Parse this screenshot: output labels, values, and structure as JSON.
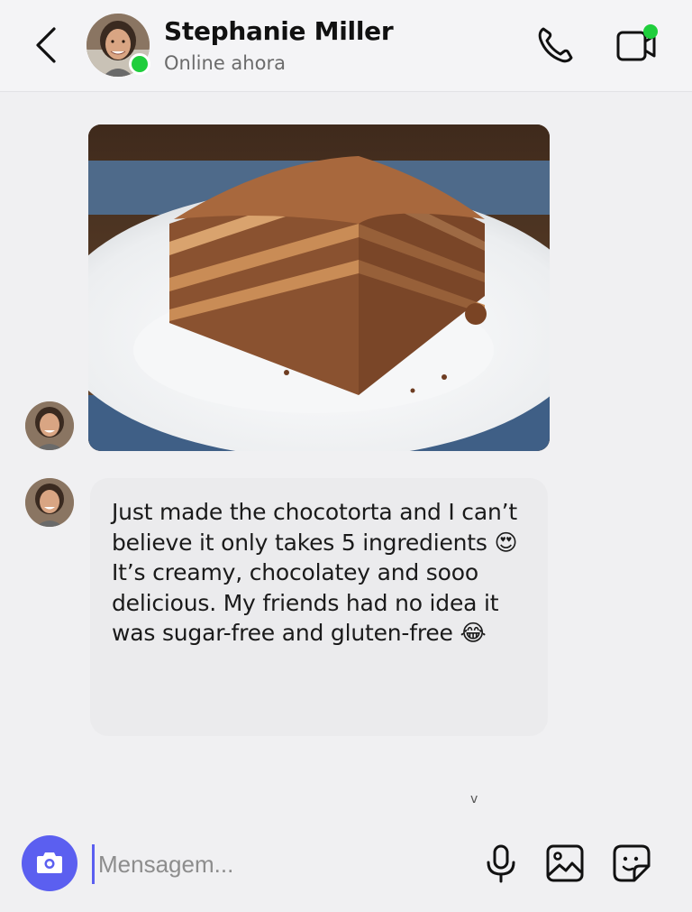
{
  "header": {
    "contact_name": "Stephanie Miller",
    "status": "Online ahora"
  },
  "icons": {
    "back": "chevron-left-icon",
    "call": "phone-icon",
    "video": "video-camera-icon",
    "camera": "camera-icon",
    "mic": "microphone-icon",
    "gallery": "image-gallery-icon",
    "sticker": "sticker-icon"
  },
  "messages": [
    {
      "type": "image",
      "description_alt": "Chocotorta cake on a white plate"
    },
    {
      "type": "text",
      "text": "Just made the chocotorta and I can’t believe it only takes 5 ingredients 😍 It’s creamy, chocolatey and sooo delicious. My friends had no idea it was sugar-free and gluten-free 😂"
    }
  ],
  "scroll_hint": "v",
  "composer": {
    "placeholder": "Mensagem..."
  },
  "colors": {
    "accent": "#5b5ff0",
    "online": "#1fce3c",
    "bubble": "#ebebed",
    "background": "#f0f0f2"
  }
}
